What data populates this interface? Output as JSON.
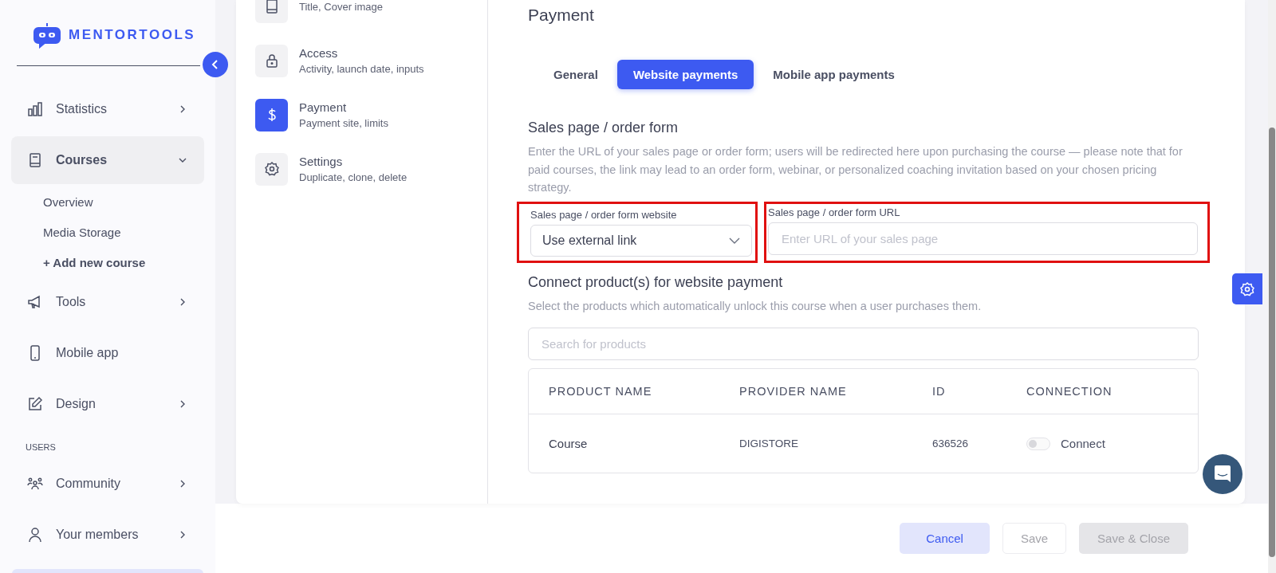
{
  "sidebar": {
    "logo": "MENTORTOOLS",
    "items": [
      {
        "kind": "item",
        "label": "Statistics",
        "selected": false,
        "expanded": false
      },
      {
        "kind": "item",
        "label": "Courses",
        "selected": true,
        "expanded": true,
        "children": [
          {
            "label": "Overview",
            "emphasis": false
          },
          {
            "label": "Media Storage",
            "emphasis": false
          },
          {
            "label": "+ Add new course",
            "emphasis": true
          }
        ]
      },
      {
        "kind": "item",
        "label": "Tools",
        "selected": false,
        "expanded": false
      },
      {
        "kind": "item",
        "label": "Mobile app",
        "selected": false
      },
      {
        "kind": "item",
        "label": "Design",
        "selected": false,
        "expanded": false
      },
      {
        "kind": "section",
        "label": "USERS"
      },
      {
        "kind": "item",
        "label": "Community",
        "selected": false,
        "expanded": false
      },
      {
        "kind": "item",
        "label": "Your members",
        "selected": false,
        "expanded": false
      }
    ]
  },
  "settings_nav": [
    {
      "subtitle": "Title, Cover image",
      "selected": false
    },
    {
      "title": "Access",
      "subtitle": "Activity, launch date, inputs",
      "selected": false
    },
    {
      "title": "Payment",
      "subtitle": "Payment site, limits",
      "selected": true
    },
    {
      "title": "Settings",
      "subtitle": "Duplicate, clone, delete",
      "selected": false
    }
  ],
  "panel": {
    "title": "Payment",
    "tabs": [
      {
        "label": "General",
        "selected": false
      },
      {
        "label": "Website payments",
        "selected": true
      },
      {
        "label": "Mobile app payments",
        "selected": false
      }
    ],
    "sales_section": {
      "heading": "Sales page / order form",
      "description": "Enter the URL of your sales page or order form; users will be redirected here upon purchasing the course — please note that for paid courses, the link may lead to an order form, webinar, or personalized coaching invitation based on your chosen pricing strategy.",
      "website_select": {
        "label": "Sales page / order form website",
        "value": "Use external link",
        "highlighted": true
      },
      "url_field": {
        "label": "Sales page / order form URL",
        "placeholder": "Enter URL of your sales page",
        "highlighted": true
      }
    },
    "connect_section": {
      "heading": "Connect product(s) for website payment",
      "description": "Select the products which automatically unlock this course when a user purchases them.",
      "search": {
        "placeholder": "Search for products"
      },
      "table": {
        "columns": [
          "PRODUCT NAME",
          "PROVIDER NAME",
          "ID",
          "CONNECTION"
        ],
        "rows": [
          {
            "product": "Course",
            "provider": "DIGISTORE",
            "id": "636526",
            "connected": false,
            "action": "Connect"
          }
        ]
      }
    }
  },
  "footer": {
    "buttons": [
      {
        "kind": "cancel",
        "label": "Cancel",
        "disabled": false
      },
      {
        "kind": "outline",
        "label": "Save",
        "disabled": true
      },
      {
        "kind": "fill",
        "label": "Save & Close",
        "disabled": true
      }
    ]
  }
}
